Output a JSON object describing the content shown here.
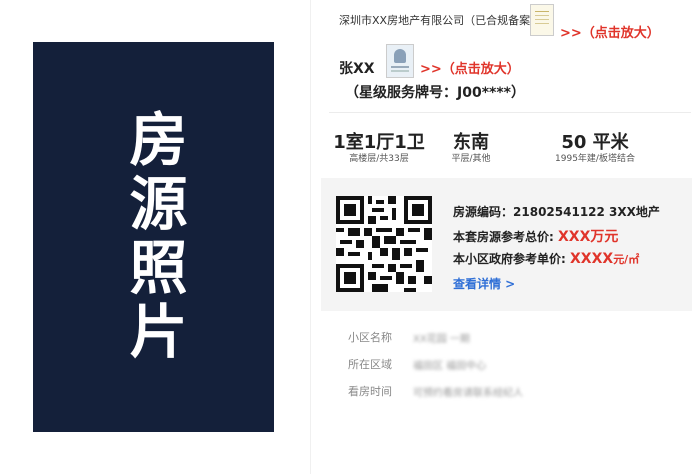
{
  "photo": {
    "label": "房源照片"
  },
  "company": {
    "name": "深圳市XX房地产有限公司（已合规备案）"
  },
  "zoom_label": ">>（点击放大）",
  "agent": {
    "name": "张XX",
    "zoom_label": ">>（点击放大）"
  },
  "star": {
    "label": "（星级服务牌号：",
    "number": "J00****",
    "close": "）"
  },
  "stats": [
    {
      "main": "1室1厅1卫",
      "sub": "高楼层/共33层"
    },
    {
      "main": "东南",
      "sub": "平层/其他"
    },
    {
      "main": "50 平米",
      "sub": "1995年建/板塔结合"
    }
  ],
  "info": {
    "code_label": "房源编码：",
    "code_value": "21802541122 3XX地产",
    "total_label": "本套房源参考总价:",
    "total_value": "XXX万元",
    "unit_label": "本小区政府参考单价:",
    "unit_value": "XXXX",
    "unit_suffix": "元/㎡",
    "more": "查看详情 >"
  },
  "details": [
    {
      "label": "小区名称",
      "value": "XX花园 一期"
    },
    {
      "label": "所在区域",
      "value": "福田区 福田中心"
    },
    {
      "label": "看房时间",
      "value": "可预约看房请联系经纪人"
    }
  ],
  "colors": {
    "accent_red": "#e0342a",
    "link_blue": "#2f6fd6",
    "photo_bg": "#14203a"
  }
}
